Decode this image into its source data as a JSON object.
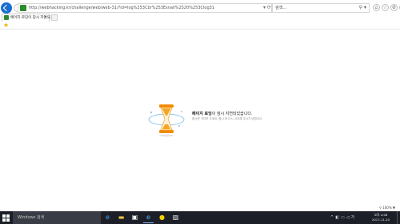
{
  "browser": {
    "url": "http://webhacking.kr/challenge/web/web-31/?id=log%253Cbr%253Esnail%2520%253Clog31",
    "search_label": "검색...",
    "tab_label": "페이지 로딩이 잠시 지연되...",
    "tab_close": "×",
    "zoom_label": "⚲ 100% ▼"
  },
  "page": {
    "message_bold": "페이지 로딩",
    "message_rest": "이 잠시 지연되었습니다.",
    "message_sub": "잠시만 기다려 주세요. 잠시 후 다시 시도해 주시기 바랍니다."
  },
  "taskbar": {
    "search_label": "Windows 검색",
    "apps": [
      "edge-icon",
      "folder-icon",
      "store-icon",
      "ie-icon",
      "chat-icon",
      "photos-icon"
    ],
    "clock_time": "오후 4:08",
    "clock_date": "2017-11-20"
  },
  "colors": {
    "accent_blue": "#1a6fd1",
    "taskbar_bg": "#1d1f28",
    "hourglass_orange": "#f28a00"
  }
}
